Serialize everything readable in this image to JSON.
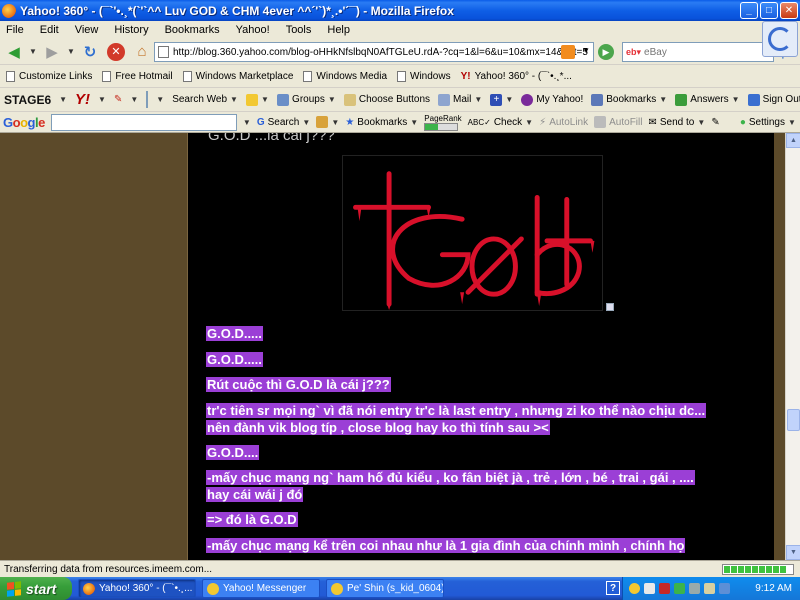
{
  "window": {
    "title": "Yahoo! 360° - (¯`'•.¸*(`'`^^ Luv GOD & CHM 4ever ^^´'`)*¸.•'´¯) - Mozilla Firefox"
  },
  "menu": [
    "File",
    "Edit",
    "View",
    "History",
    "Bookmarks",
    "Yahoo!",
    "Tools",
    "Help"
  ],
  "navigation": {
    "url": "http://blog.360.yahoo.com/blog-oHHkNfslbqN0AfTGLeU.rdA-?cq=1&l=6&u=10&mx=14&lmt=5",
    "search_engine": "eBay",
    "search_placeholder": "eBay"
  },
  "bookmarks": [
    "Customize Links",
    "Free Hotmail",
    "Windows Marketplace",
    "Windows Media",
    "Windows",
    "Yahoo! 360° - (¯`•.¸*..."
  ],
  "yahoo_toolbar": {
    "stage6": "STAGE6",
    "yahoo": "Y!",
    "items": [
      "Search Web",
      "Groups",
      "Choose Buttons",
      "Mail",
      "My Yahoo!",
      "Bookmarks",
      "Answers",
      "Sign Out"
    ]
  },
  "google_toolbar": {
    "logo": "Google",
    "items": [
      "Search",
      "Bookmarks",
      "PageRank",
      "Check",
      "AutoLink",
      "AutoFill",
      "Send to",
      "Settings"
    ]
  },
  "post": {
    "title": "G.O.D ...là cái j???",
    "lines": [
      "G.O.D.....",
      "G.O.D.....",
      "Rút cuộc thì G.O.D là cái j???",
      "tr'c tiên sr mọi ng` vì đã nói entry tr'c là last entry , nhưng zi ko thể nào chịu dc...",
      "nên đành vik blog típ , close blog hay ko thì tính sau ><",
      "G.O.D....",
      "-mấy chục mạng ng` ham hố đủ kiểu , ko fân biệt jà , trẻ , lớn , bé , trai , gái , ....",
      "hay cái wái j đó",
      "=> đó là G.O.D",
      "-mấy chục mạng kể trên coi nhau như là 1 gia đình của chính mình , chính họ"
    ]
  },
  "status": {
    "text": "Transferring data from resources.imeem.com..."
  },
  "taskbar": {
    "start": "start",
    "tasks": [
      "Yahoo! 360° - (¯`•.¸...",
      "Yahoo! Messenger",
      "Pe' Shin (s_kid_0604)..."
    ],
    "clock": "9:12 AM"
  },
  "colors": {
    "highlight": "#9b3fd6",
    "page_bg": "#5c4a2a",
    "post_bg": "#000000",
    "logo_red": "#d8102a"
  }
}
